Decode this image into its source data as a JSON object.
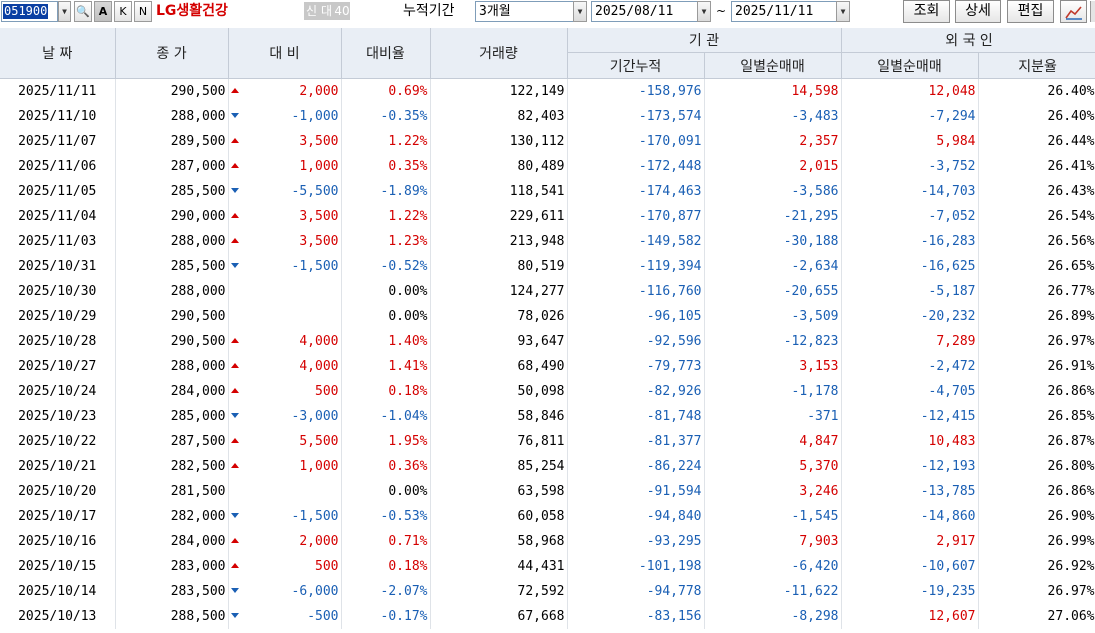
{
  "toolbar": {
    "code": "051900",
    "btn_search": "🔍",
    "btn_a": "A",
    "btn_k": "K",
    "btn_n": "N",
    "stock_name": "LG생활건강",
    "tag_new": "신",
    "tag_loan": "대",
    "tag_num": "40",
    "period_label": "누적기간",
    "period_value": "3개월",
    "start_date": "2025/08/11",
    "range_sep": "~",
    "end_date": "2025/11/11",
    "query_label": "조회",
    "detail_label": "상세",
    "edit_label": "편집"
  },
  "table": {
    "headers": {
      "date": "날  짜",
      "close": "종  가",
      "diff": "대  비",
      "rate": "대비율",
      "volume": "거래량",
      "inst": "기    관",
      "inst_cum": "기간누적",
      "inst_daily": "일별순매매",
      "foreign": "외 국 인",
      "foreign_daily": "일별순매매",
      "foreign_share": "지분율"
    },
    "rows": [
      {
        "date": "2025/11/11",
        "close": "290,500",
        "dir": "up",
        "diff": "2,000",
        "diff_c": "r",
        "rate": "0.69%",
        "rate_c": "r",
        "volume": "122,149",
        "cum": "-158,976",
        "cum_c": "b",
        "inst": "14,598",
        "inst_c": "r",
        "frg": "12,048",
        "frg_c": "r",
        "share": "26.40%"
      },
      {
        "date": "2025/11/10",
        "close": "288,000",
        "dir": "down",
        "diff": "-1,000",
        "diff_c": "b",
        "rate": "-0.35%",
        "rate_c": "b",
        "volume": "82,403",
        "cum": "-173,574",
        "cum_c": "b",
        "inst": "-3,483",
        "inst_c": "b",
        "frg": "-7,294",
        "frg_c": "b",
        "share": "26.40%"
      },
      {
        "date": "2025/11/07",
        "close": "289,500",
        "dir": "up",
        "diff": "3,500",
        "diff_c": "r",
        "rate": "1.22%",
        "rate_c": "r",
        "volume": "130,112",
        "cum": "-170,091",
        "cum_c": "b",
        "inst": "2,357",
        "inst_c": "r",
        "frg": "5,984",
        "frg_c": "r",
        "share": "26.44%"
      },
      {
        "date": "2025/11/06",
        "close": "287,000",
        "dir": "up",
        "diff": "1,000",
        "diff_c": "r",
        "rate": "0.35%",
        "rate_c": "r",
        "volume": "80,489",
        "cum": "-172,448",
        "cum_c": "b",
        "inst": "2,015",
        "inst_c": "r",
        "frg": "-3,752",
        "frg_c": "b",
        "share": "26.41%"
      },
      {
        "date": "2025/11/05",
        "close": "285,500",
        "dir": "down",
        "diff": "-5,500",
        "diff_c": "b",
        "rate": "-1.89%",
        "rate_c": "b",
        "volume": "118,541",
        "cum": "-174,463",
        "cum_c": "b",
        "inst": "-3,586",
        "inst_c": "b",
        "frg": "-14,703",
        "frg_c": "b",
        "share": "26.43%"
      },
      {
        "date": "2025/11/04",
        "close": "290,000",
        "dir": "up",
        "diff": "3,500",
        "diff_c": "r",
        "rate": "1.22%",
        "rate_c": "r",
        "volume": "229,611",
        "cum": "-170,877",
        "cum_c": "b",
        "inst": "-21,295",
        "inst_c": "b",
        "frg": "-7,052",
        "frg_c": "b",
        "share": "26.54%"
      },
      {
        "date": "2025/11/03",
        "close": "288,000",
        "dir": "up",
        "diff": "3,500",
        "diff_c": "r",
        "rate": "1.23%",
        "rate_c": "r",
        "volume": "213,948",
        "cum": "-149,582",
        "cum_c": "b",
        "inst": "-30,188",
        "inst_c": "b",
        "frg": "-16,283",
        "frg_c": "b",
        "share": "26.56%"
      },
      {
        "date": "2025/10/31",
        "close": "285,500",
        "dir": "down",
        "diff": "-1,500",
        "diff_c": "b",
        "rate": "-0.52%",
        "rate_c": "b",
        "volume": "80,519",
        "cum": "-119,394",
        "cum_c": "b",
        "inst": "-2,634",
        "inst_c": "b",
        "frg": "-16,625",
        "frg_c": "b",
        "share": "26.65%"
      },
      {
        "date": "2025/10/30",
        "close": "288,000",
        "dir": "none",
        "diff": "",
        "diff_c": "k",
        "rate": "0.00%",
        "rate_c": "k",
        "volume": "124,277",
        "cum": "-116,760",
        "cum_c": "b",
        "inst": "-20,655",
        "inst_c": "b",
        "frg": "-5,187",
        "frg_c": "b",
        "share": "26.77%"
      },
      {
        "date": "2025/10/29",
        "close": "290,500",
        "dir": "none",
        "diff": "",
        "diff_c": "k",
        "rate": "0.00%",
        "rate_c": "k",
        "volume": "78,026",
        "cum": "-96,105",
        "cum_c": "b",
        "inst": "-3,509",
        "inst_c": "b",
        "frg": "-20,232",
        "frg_c": "b",
        "share": "26.89%"
      },
      {
        "date": "2025/10/28",
        "close": "290,500",
        "dir": "up",
        "diff": "4,000",
        "diff_c": "r",
        "rate": "1.40%",
        "rate_c": "r",
        "volume": "93,647",
        "cum": "-92,596",
        "cum_c": "b",
        "inst": "-12,823",
        "inst_c": "b",
        "frg": "7,289",
        "frg_c": "r",
        "share": "26.97%"
      },
      {
        "date": "2025/10/27",
        "close": "288,000",
        "dir": "up",
        "diff": "4,000",
        "diff_c": "r",
        "rate": "1.41%",
        "rate_c": "r",
        "volume": "68,490",
        "cum": "-79,773",
        "cum_c": "b",
        "inst": "3,153",
        "inst_c": "r",
        "frg": "-2,472",
        "frg_c": "b",
        "share": "26.91%"
      },
      {
        "date": "2025/10/24",
        "close": "284,000",
        "dir": "up",
        "diff": "500",
        "diff_c": "r",
        "rate": "0.18%",
        "rate_c": "r",
        "volume": "50,098",
        "cum": "-82,926",
        "cum_c": "b",
        "inst": "-1,178",
        "inst_c": "b",
        "frg": "-4,705",
        "frg_c": "b",
        "share": "26.86%"
      },
      {
        "date": "2025/10/23",
        "close": "285,000",
        "dir": "down",
        "diff": "-3,000",
        "diff_c": "b",
        "rate": "-1.04%",
        "rate_c": "b",
        "volume": "58,846",
        "cum": "-81,748",
        "cum_c": "b",
        "inst": "-371",
        "inst_c": "b",
        "frg": "-12,415",
        "frg_c": "b",
        "share": "26.85%"
      },
      {
        "date": "2025/10/22",
        "close": "287,500",
        "dir": "up",
        "diff": "5,500",
        "diff_c": "r",
        "rate": "1.95%",
        "rate_c": "r",
        "volume": "76,811",
        "cum": "-81,377",
        "cum_c": "b",
        "inst": "4,847",
        "inst_c": "r",
        "frg": "10,483",
        "frg_c": "r",
        "share": "26.87%"
      },
      {
        "date": "2025/10/21",
        "close": "282,500",
        "dir": "up",
        "diff": "1,000",
        "diff_c": "r",
        "rate": "0.36%",
        "rate_c": "r",
        "volume": "85,254",
        "cum": "-86,224",
        "cum_c": "b",
        "inst": "5,370",
        "inst_c": "r",
        "frg": "-12,193",
        "frg_c": "b",
        "share": "26.80%"
      },
      {
        "date": "2025/10/20",
        "close": "281,500",
        "dir": "none",
        "diff": "",
        "diff_c": "k",
        "rate": "0.00%",
        "rate_c": "k",
        "volume": "63,598",
        "cum": "-91,594",
        "cum_c": "b",
        "inst": "3,246",
        "inst_c": "r",
        "frg": "-13,785",
        "frg_c": "b",
        "share": "26.86%"
      },
      {
        "date": "2025/10/17",
        "close": "282,000",
        "dir": "down",
        "diff": "-1,500",
        "diff_c": "b",
        "rate": "-0.53%",
        "rate_c": "b",
        "volume": "60,058",
        "cum": "-94,840",
        "cum_c": "b",
        "inst": "-1,545",
        "inst_c": "b",
        "frg": "-14,860",
        "frg_c": "b",
        "share": "26.90%"
      },
      {
        "date": "2025/10/16",
        "close": "284,000",
        "dir": "up",
        "diff": "2,000",
        "diff_c": "r",
        "rate": "0.71%",
        "rate_c": "r",
        "volume": "58,968",
        "cum": "-93,295",
        "cum_c": "b",
        "inst": "7,903",
        "inst_c": "r",
        "frg": "2,917",
        "frg_c": "r",
        "share": "26.99%"
      },
      {
        "date": "2025/10/15",
        "close": "283,000",
        "dir": "up",
        "diff": "500",
        "diff_c": "r",
        "rate": "0.18%",
        "rate_c": "r",
        "volume": "44,431",
        "cum": "-101,198",
        "cum_c": "b",
        "inst": "-6,420",
        "inst_c": "b",
        "frg": "-10,607",
        "frg_c": "b",
        "share": "26.92%"
      },
      {
        "date": "2025/10/14",
        "close": "283,500",
        "dir": "down",
        "diff": "-6,000",
        "diff_c": "b",
        "rate": "-2.07%",
        "rate_c": "b",
        "volume": "72,592",
        "cum": "-94,778",
        "cum_c": "b",
        "inst": "-11,622",
        "inst_c": "b",
        "frg": "-19,235",
        "frg_c": "b",
        "share": "26.97%"
      },
      {
        "date": "2025/10/13",
        "close": "288,500",
        "dir": "down",
        "diff": "-500",
        "diff_c": "b",
        "rate": "-0.17%",
        "rate_c": "b",
        "volume": "67,668",
        "cum": "-83,156",
        "cum_c": "b",
        "inst": "-8,298",
        "inst_c": "b",
        "frg": "12,607",
        "frg_c": "r",
        "share": "27.06%"
      }
    ]
  },
  "colors": {
    "up": "#d40000",
    "down": "#1a5fb4",
    "header_bg": "#e9eef5"
  }
}
